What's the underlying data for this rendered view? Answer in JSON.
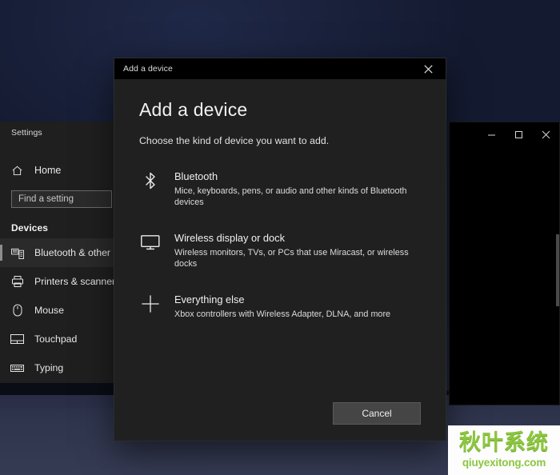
{
  "desktop": {
    "name": "windows-desktop-wallpaper"
  },
  "background_window": {
    "controls": [
      {
        "name": "minimize-button",
        "glyph": "minimize"
      },
      {
        "name": "maximize-button",
        "glyph": "maximize"
      },
      {
        "name": "close-button",
        "glyph": "close"
      }
    ]
  },
  "settings_window": {
    "title": "Settings",
    "home_label": "Home",
    "search": {
      "placeholder": "Find a setting",
      "value": ""
    },
    "group_heading": "Devices",
    "items": [
      {
        "label": "Bluetooth & other devi",
        "icon": "bluetooth-devices-icon",
        "selected": true
      },
      {
        "label": "Printers & scanners",
        "icon": "printer-icon",
        "selected": false
      },
      {
        "label": "Mouse",
        "icon": "mouse-icon",
        "selected": false
      },
      {
        "label": "Touchpad",
        "icon": "touchpad-icon",
        "selected": false
      },
      {
        "label": "Typing",
        "icon": "keyboard-icon",
        "selected": false
      }
    ]
  },
  "dialog": {
    "titlebar_text": "Add a device",
    "close_label": "Close",
    "heading": "Add a device",
    "subtitle": "Choose the kind of device you want to add.",
    "options": [
      {
        "icon": "bluetooth-icon",
        "title": "Bluetooth",
        "description": "Mice, keyboards, pens, or audio and other kinds of Bluetooth devices"
      },
      {
        "icon": "monitor-icon",
        "title": "Wireless display or dock",
        "description": "Wireless monitors, TVs, or PCs that use Miracast, or wireless docks"
      },
      {
        "icon": "plus-icon",
        "title": "Everything else",
        "description": "Xbox controllers with Wireless Adapter, DLNA, and more"
      }
    ],
    "cancel_label": "Cancel"
  },
  "watermark": {
    "brand_cn": "秋叶系统",
    "url": "qiuyexitong.com",
    "color": "#8cc63f"
  },
  "colors": {
    "dialog_bg": "#202020",
    "settings_bg": "#1f1f1f",
    "titlebar_bg": "#000000",
    "button_bg": "#454545",
    "text_primary": "#f0f0f0",
    "text_secondary": "#dcdcdc"
  }
}
